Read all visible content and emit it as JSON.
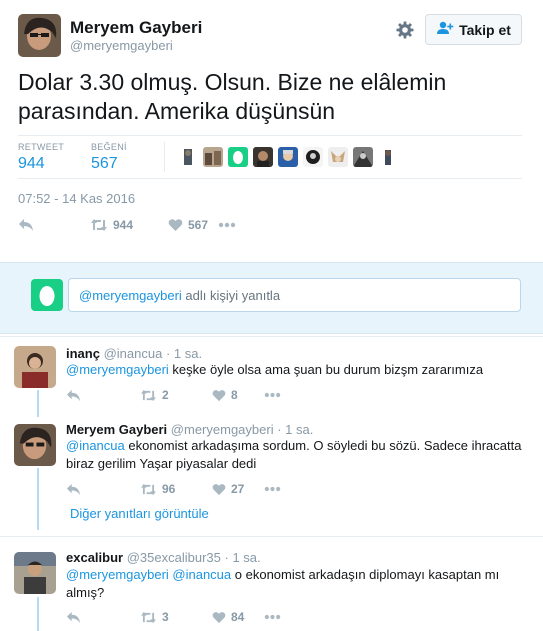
{
  "tweet": {
    "author_name": "Meryem Gayberi",
    "author_handle": "@meryemgayberi",
    "follow_label": "Takip et",
    "text_line1": "Dolar 3.30 olmuş. Olsun. Bize ne elâlemin",
    "text_line2": "parasından. Amerika düşünsün",
    "retweet_label": "RETWEET",
    "retweet_count": "944",
    "like_label": "BEĞENİ",
    "like_count": "567",
    "timestamp": "07:52 - 14 Kas 2016",
    "action_retweets": "944",
    "action_likes": "567"
  },
  "reply_box": {
    "mention": "@meryemgayberi",
    "text": " adlı kişiyi yanıtla"
  },
  "replies": [
    {
      "name": "inanç",
      "handle": "@inancua",
      "time": "· 1 sa.",
      "mention": "@meryemgayberi",
      "text": " keşke öyle olsa ama şuan bu durum bizşm zararımıza",
      "retweets": "2",
      "likes": "8"
    },
    {
      "name": "Meryem Gayberi",
      "handle": "@meryemgayberi",
      "time": "· 1 sa.",
      "mention": "@inancua",
      "text": " ekonomist arkadaşıma sordum. O söyledi bu sözü. Sadece ihracatta biraz gerilim Yaşar piyasalar dedi",
      "retweets": "96",
      "likes": "27",
      "more": "Diğer yanıtları görüntüle"
    },
    {
      "name": "excalibur",
      "handle": "@35excalibur35",
      "time": "· 1 sa.",
      "mention1": "@meryemgayberi",
      "mention2": "@inancua",
      "text": " o ekonomist arkadaşın diplomayı kasaptan mı almış?",
      "retweets": "3",
      "likes": "84"
    }
  ],
  "colors": {
    "accent": "#1b95e0",
    "muted": "#8899a6",
    "reply_bg": "#e8f4fb",
    "thread_line": "#b3dbf5",
    "egg_green": "#19cf86"
  },
  "icons": [
    "gear-icon",
    "follow-person-icon",
    "reply-icon",
    "retweet-icon",
    "heart-icon",
    "more-icon",
    "egg-avatar-icon"
  ]
}
